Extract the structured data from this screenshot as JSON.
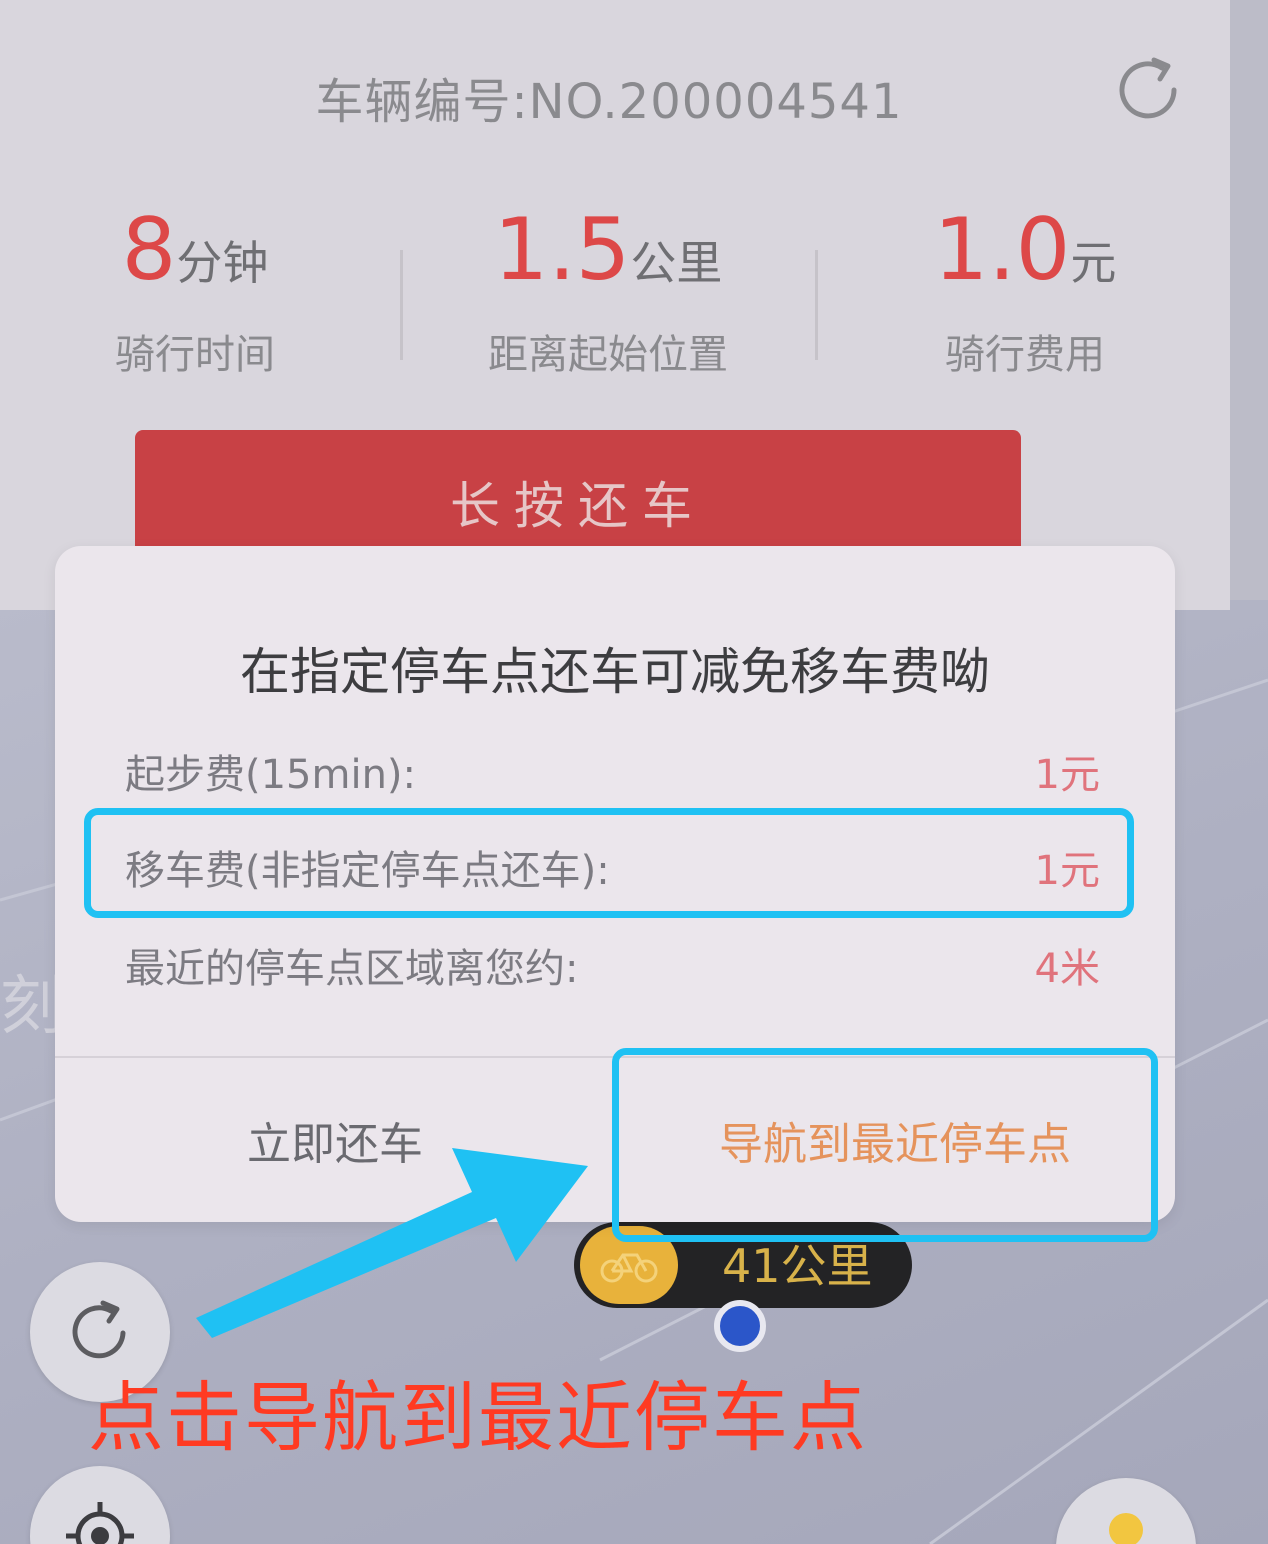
{
  "header": {
    "vehicle_number": "车辆编号:NO.200004541",
    "refresh_icon": "refresh-icon"
  },
  "stats": [
    {
      "value": "8",
      "unit": "分钟",
      "label": "骑行时间"
    },
    {
      "value": "1.5",
      "unit": "公里",
      "label": "距离起始位置"
    },
    {
      "value": "1.0",
      "unit": "元",
      "label": "骑行费用"
    }
  ],
  "return_button": {
    "label": "长按还车"
  },
  "dialog": {
    "title": "在指定停车点还车可减免移车费呦",
    "rows": [
      {
        "key": "起步费(15min):",
        "value": "1元"
      },
      {
        "key": "移车费(非指定停车点还车):",
        "value": "1元"
      },
      {
        "key": "最近的停车点区域离您约:",
        "value": "4米"
      }
    ],
    "button_return_now": "立即还车",
    "button_navigate": "导航到最近停车点"
  },
  "map": {
    "bike_distance": "41公里",
    "partial_text": "刻"
  },
  "annotation": {
    "text": "点击导航到最近停车点"
  },
  "colors": {
    "accent_red": "#dd4848",
    "button_red": "#c84145",
    "nav_orange": "#e5935c",
    "highlight_blue": "#1fc1f3",
    "annotation_red": "#ff3a22"
  }
}
